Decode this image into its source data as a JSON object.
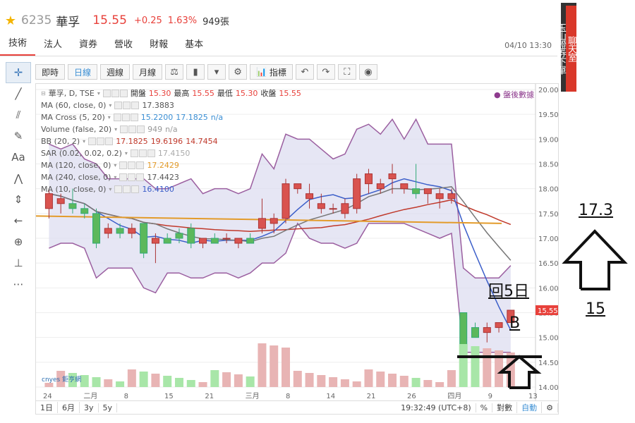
{
  "header": {
    "code": "6235",
    "name": "華孚",
    "price": "15.55",
    "change": "+0.25",
    "percent": "1.63%",
    "volume": "949張"
  },
  "tabs": [
    "技術",
    "法人",
    "資券",
    "營收",
    "財報",
    "基本"
  ],
  "timestamp": "04/10 13:30",
  "banner": {
    "top": "聊天室",
    "bottom": "玉山證券下單"
  },
  "toolbar": {
    "buttons": [
      "即時",
      "日線",
      "週線",
      "月線"
    ],
    "indicator": "指標"
  },
  "legend": {
    "main": {
      "name": "華孚, D, TSE",
      "open_lbl": "開盤",
      "open": "15.30",
      "high_lbl": "最高",
      "high": "15.55",
      "low_lbl": "最低",
      "low": "15.30",
      "close_lbl": "收盤",
      "close": "15.55"
    },
    "rows": [
      {
        "label": "MA (60, close, 0)",
        "values": [
          "17.3883"
        ]
      },
      {
        "label": "MA Cross (5, 20)",
        "values": [
          "15.2200",
          "17.1825",
          "n/a"
        ]
      },
      {
        "label": "Volume (false, 20)",
        "values": [
          "949",
          "n/a"
        ]
      },
      {
        "label": "BB (20, 2)",
        "values": [
          "17.1825",
          "19.6196",
          "14.7454"
        ]
      },
      {
        "label": "SAR (0.02, 0.02, 0.2)",
        "values": [
          "17.4150"
        ]
      },
      {
        "label": "MA (120, close, 0)",
        "values": [
          "17.2429"
        ]
      },
      {
        "label": "MA (240, close, 0)",
        "values": [
          "17.4423"
        ]
      },
      {
        "label": "MA (10, close, 0)",
        "values": [
          "16.4100"
        ]
      }
    ]
  },
  "after_hours": "盤後數據",
  "price_label": "15.55",
  "bottom": {
    "ranges": [
      "1日",
      "6月",
      "3y",
      "5y"
    ],
    "time": "19:32:49 (UTC+8)",
    "pct": "%",
    "log": "對數",
    "auto": "自動"
  },
  "logo_text": "cnyes 鉅亨網",
  "annotations": {
    "target": "17.3",
    "support": "15",
    "back5": "回5日",
    "signal": "B"
  },
  "chart_data": {
    "type": "candlestick",
    "y_axis_ticks": [
      "20.00",
      "19.50",
      "19.00",
      "18.50",
      "18.00",
      "17.50",
      "17.00",
      "16.50",
      "16.00",
      "15.50",
      "15.00",
      "14.50",
      "14.00"
    ],
    "x_axis_ticks": [
      "24",
      "二月",
      "8",
      "15",
      "21",
      "三月",
      "8",
      "14",
      "21",
      "26",
      "四月",
      "9",
      "13"
    ],
    "ylim": [
      14.0,
      20.0
    ],
    "candles": [
      {
        "o": 17.6,
        "h": 18.0,
        "l": 17.4,
        "c": 17.9
      },
      {
        "o": 17.7,
        "h": 17.9,
        "l": 17.5,
        "c": 17.8
      },
      {
        "o": 17.7,
        "h": 18.0,
        "l": 17.5,
        "c": 17.6
      },
      {
        "o": 17.6,
        "h": 17.7,
        "l": 17.4,
        "c": 17.5
      },
      {
        "o": 17.5,
        "h": 17.6,
        "l": 16.8,
        "c": 16.9
      },
      {
        "o": 17.1,
        "h": 17.3,
        "l": 17.0,
        "c": 17.2
      },
      {
        "o": 17.2,
        "h": 17.3,
        "l": 17.0,
        "c": 17.1
      },
      {
        "o": 17.1,
        "h": 17.3,
        "l": 17.0,
        "c": 17.2
      },
      {
        "o": 17.3,
        "h": 17.3,
        "l": 16.6,
        "c": 16.7
      },
      {
        "o": 16.9,
        "h": 17.1,
        "l": 16.5,
        "c": 17.0
      },
      {
        "o": 17.0,
        "h": 17.1,
        "l": 16.9,
        "c": 16.9
      },
      {
        "o": 17.1,
        "h": 17.2,
        "l": 16.9,
        "c": 17.0
      },
      {
        "o": 17.2,
        "h": 17.3,
        "l": 16.8,
        "c": 16.9
      },
      {
        "o": 16.9,
        "h": 17.0,
        "l": 16.8,
        "c": 17.0
      },
      {
        "o": 17.0,
        "h": 17.1,
        "l": 16.9,
        "c": 16.9
      },
      {
        "o": 17.0,
        "h": 17.1,
        "l": 16.9,
        "c": 17.0
      },
      {
        "o": 16.9,
        "h": 17.0,
        "l": 16.8,
        "c": 17.0
      },
      {
        "o": 17.0,
        "h": 17.1,
        "l": 16.9,
        "c": 16.9
      },
      {
        "o": 17.2,
        "h": 17.8,
        "l": 17.1,
        "c": 17.4
      },
      {
        "o": 17.3,
        "h": 17.5,
        "l": 17.1,
        "c": 17.4
      },
      {
        "o": 17.4,
        "h": 18.2,
        "l": 17.3,
        "c": 18.1
      },
      {
        "o": 18.0,
        "h": 18.1,
        "l": 17.9,
        "c": 18.1
      },
      {
        "o": 17.8,
        "h": 18.1,
        "l": 17.6,
        "c": 17.9
      },
      {
        "o": 17.6,
        "h": 17.9,
        "l": 17.5,
        "c": 17.7
      },
      {
        "o": 17.6,
        "h": 17.7,
        "l": 17.5,
        "c": 17.6
      },
      {
        "o": 17.5,
        "h": 17.8,
        "l": 17.4,
        "c": 17.7
      },
      {
        "o": 17.6,
        "h": 18.3,
        "l": 17.5,
        "c": 18.2
      },
      {
        "o": 18.1,
        "h": 18.4,
        "l": 17.9,
        "c": 18.3
      },
      {
        "o": 18.0,
        "h": 18.2,
        "l": 17.9,
        "c": 18.1
      },
      {
        "o": 18.2,
        "h": 18.5,
        "l": 17.9,
        "c": 18.3
      },
      {
        "o": 18.0,
        "h": 18.1,
        "l": 17.9,
        "c": 18.1
      },
      {
        "o": 18.0,
        "h": 18.5,
        "l": 17.8,
        "c": 17.9
      },
      {
        "o": 17.9,
        "h": 18.0,
        "l": 17.7,
        "c": 18.0
      },
      {
        "o": 17.8,
        "h": 18.0,
        "l": 17.6,
        "c": 17.9
      },
      {
        "o": 17.8,
        "h": 18.0,
        "l": 17.7,
        "c": 17.9
      },
      {
        "o": 15.5,
        "h": 15.5,
        "l": 14.6,
        "c": 14.7
      },
      {
        "o": 15.2,
        "h": 15.3,
        "l": 15.0,
        "c": 15.0
      },
      {
        "o": 15.1,
        "h": 15.3,
        "l": 14.9,
        "c": 15.2
      },
      {
        "o": 15.2,
        "h": 15.3,
        "l": 15.1,
        "c": 15.3
      },
      {
        "o": 15.3,
        "h": 15.55,
        "l": 15.3,
        "c": 15.55
      }
    ]
  }
}
